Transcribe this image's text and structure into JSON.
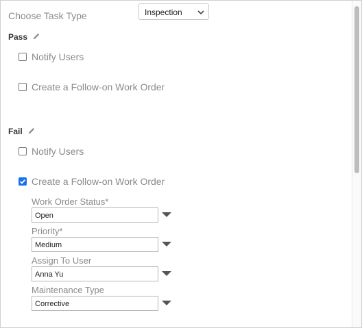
{
  "task_type": {
    "label": "Choose Task Type",
    "selected": "Inspection"
  },
  "pass": {
    "title": "Pass",
    "notify_users": {
      "label": "Notify Users",
      "checked": false
    },
    "follow_on": {
      "label": "Create a Follow-on Work Order",
      "checked": false
    }
  },
  "fail": {
    "title": "Fail",
    "notify_users": {
      "label": "Notify Users",
      "checked": false
    },
    "follow_on": {
      "label": "Create a Follow-on Work Order",
      "checked": true
    },
    "fields": {
      "status": {
        "label": "Work Order Status*",
        "value": "Open"
      },
      "priority": {
        "label": "Priority*",
        "value": "Medium"
      },
      "assign": {
        "label": "Assign To User",
        "value": "Anna Yu"
      },
      "maintenance": {
        "label": "Maintenance Type",
        "value": "Corrective"
      }
    }
  },
  "icons": {
    "edit": "pencil-icon",
    "dropdown": "caret-down-icon",
    "select": "chevron-down-icon"
  },
  "colors": {
    "checkbox_checked": "#1a73e8"
  }
}
